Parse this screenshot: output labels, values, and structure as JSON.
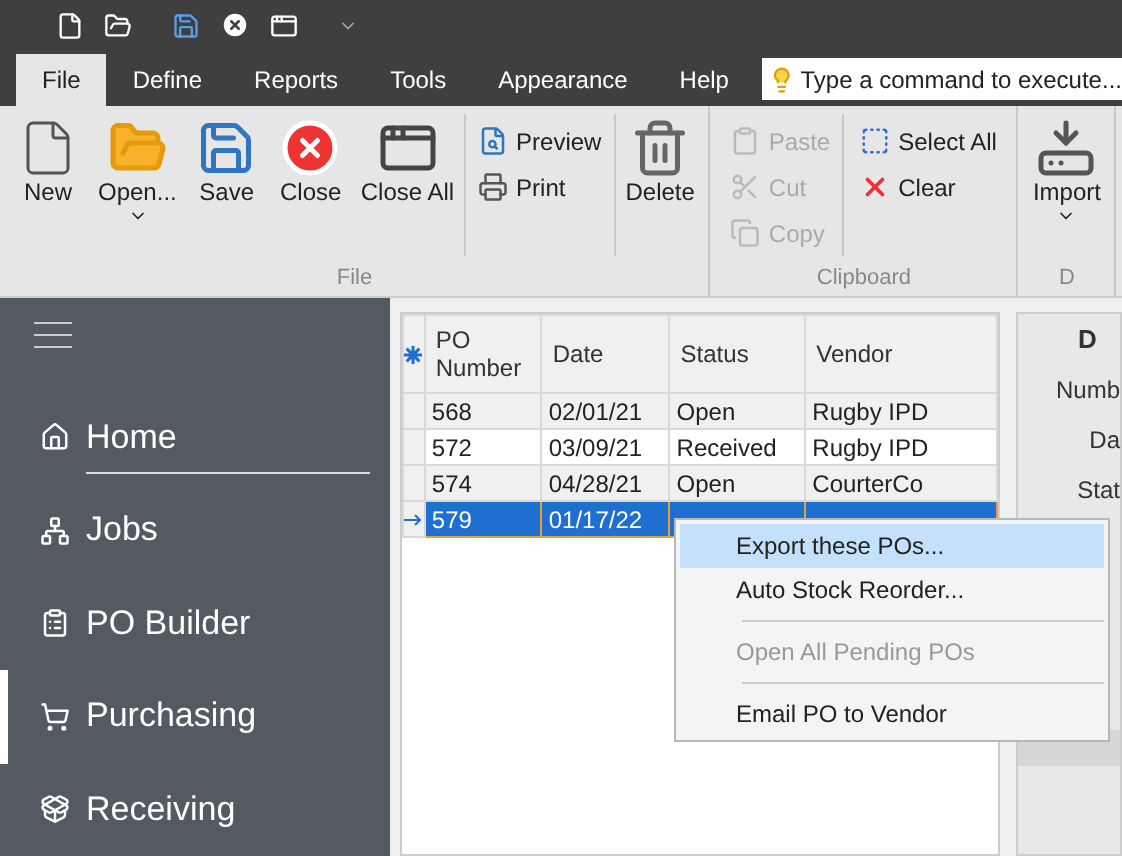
{
  "ribbon": {
    "tabs": [
      {
        "label": "File",
        "selected": true
      },
      {
        "label": "Define",
        "selected": false
      },
      {
        "label": "Reports",
        "selected": false
      },
      {
        "label": "Tools",
        "selected": false
      },
      {
        "label": "Appearance",
        "selected": false
      },
      {
        "label": "Help",
        "selected": false
      }
    ],
    "command_search": {
      "placeholder": "Type a command to execute..."
    },
    "groups": [
      {
        "label": "File",
        "items": [
          {
            "label": "New",
            "kind": "large",
            "disabled": false,
            "dropdown": false
          },
          {
            "label": "Open...",
            "kind": "large",
            "disabled": false,
            "dropdown": true
          },
          {
            "label": "Save",
            "kind": "large",
            "disabled": false,
            "dropdown": false
          },
          {
            "label": "Close",
            "kind": "large",
            "disabled": false,
            "dropdown": false
          },
          {
            "label": "Close All",
            "kind": "large",
            "disabled": false,
            "dropdown": false
          },
          {
            "label": "Preview",
            "kind": "small",
            "disabled": false
          },
          {
            "label": "Print",
            "kind": "small",
            "disabled": false
          },
          {
            "label": "Delete",
            "kind": "large",
            "disabled": false,
            "dropdown": false
          }
        ]
      },
      {
        "label": "Clipboard",
        "items": [
          {
            "label": "Paste",
            "kind": "small",
            "disabled": true
          },
          {
            "label": "Cut",
            "kind": "small",
            "disabled": true
          },
          {
            "label": "Copy",
            "kind": "small",
            "disabled": true
          },
          {
            "label": "Select All",
            "kind": "small",
            "disabled": false
          },
          {
            "label": "Clear",
            "kind": "small",
            "disabled": false
          }
        ]
      },
      {
        "label": "D",
        "items": [
          {
            "label": "Import",
            "kind": "large",
            "disabled": false,
            "dropdown": true
          }
        ]
      }
    ]
  },
  "sidebar": {
    "items": [
      {
        "label": "Home",
        "selected": false
      },
      {
        "label": "Jobs",
        "selected": false
      },
      {
        "label": "PO Builder",
        "selected": false
      },
      {
        "label": "Purchasing",
        "selected": true
      },
      {
        "label": "Receiving",
        "selected": false
      }
    ]
  },
  "grid": {
    "columns": [
      "PO Number",
      "Date",
      "Status",
      "Vendor"
    ],
    "rows": [
      {
        "cells": [
          "568",
          "02/01/21",
          "Open",
          "Rugby IPD"
        ],
        "selected": false
      },
      {
        "cells": [
          "572",
          "03/09/21",
          "Received",
          "Rugby IPD"
        ],
        "selected": false
      },
      {
        "cells": [
          "574",
          "04/28/21",
          "Open",
          "CourterCo"
        ],
        "selected": false
      },
      {
        "cells": [
          "579",
          "01/17/22"
        ],
        "selected": true
      }
    ]
  },
  "context_menu": {
    "items": [
      {
        "kind": "item",
        "label": "Export these POs...",
        "selected": true,
        "disabled": false
      },
      {
        "kind": "item",
        "label": "Auto Stock Reorder...",
        "selected": false,
        "disabled": false
      },
      {
        "kind": "separator"
      },
      {
        "kind": "item",
        "label": "Open All Pending POs",
        "selected": false,
        "disabled": true
      },
      {
        "kind": "separator"
      },
      {
        "kind": "item",
        "label": "Email PO to Vendor",
        "selected": false,
        "disabled": false
      }
    ]
  },
  "details": {
    "heading": "D",
    "labels": [
      "Numb",
      "Da",
      "Stat"
    ]
  }
}
